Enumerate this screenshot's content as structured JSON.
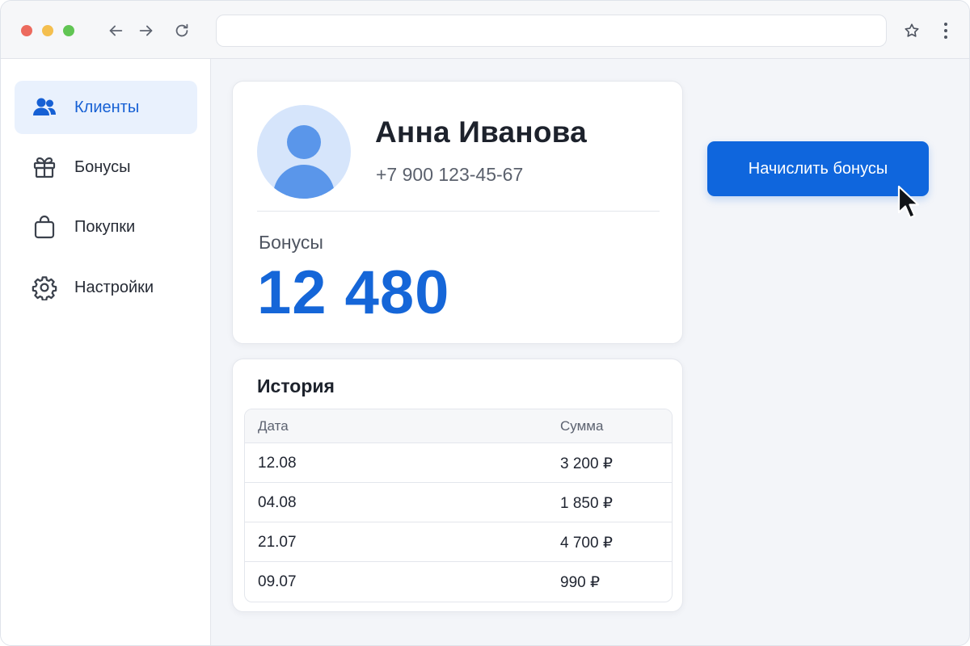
{
  "colors": {
    "accent": "#1566d8",
    "button": "#0f66dd",
    "sidebar_active_bg": "#e9f1fd",
    "avatar_bg": "#d6e5fb"
  },
  "browser": {
    "address_value": "",
    "icons": [
      "arrow-left-icon",
      "arrow-right-icon",
      "reload-icon",
      "star-icon",
      "kebab-menu-icon"
    ]
  },
  "sidebar": {
    "items": [
      {
        "label": "Клиенты",
        "icon": "users-icon",
        "active": true
      },
      {
        "label": "Бонусы",
        "icon": "gift-icon",
        "active": false
      },
      {
        "label": "Покупки",
        "icon": "shopping-bag-icon",
        "active": false
      },
      {
        "label": "Настройки",
        "icon": "gear-icon",
        "active": false
      }
    ]
  },
  "client": {
    "name": "Анна Иванова",
    "phone": "+7 900 123-45-67",
    "bonus_label": "Бонусы",
    "bonus_value": "12 480"
  },
  "actions": {
    "accrue_label": "Начислить бонусы"
  },
  "history": {
    "title": "История",
    "columns": [
      "Дата",
      "Сумма"
    ],
    "rows": [
      [
        "12.08",
        "3 200 ₽"
      ],
      [
        "04.08",
        "1 850 ₽"
      ],
      [
        "21.07",
        "4 700 ₽"
      ],
      [
        "09.07",
        "990 ₽"
      ]
    ]
  }
}
